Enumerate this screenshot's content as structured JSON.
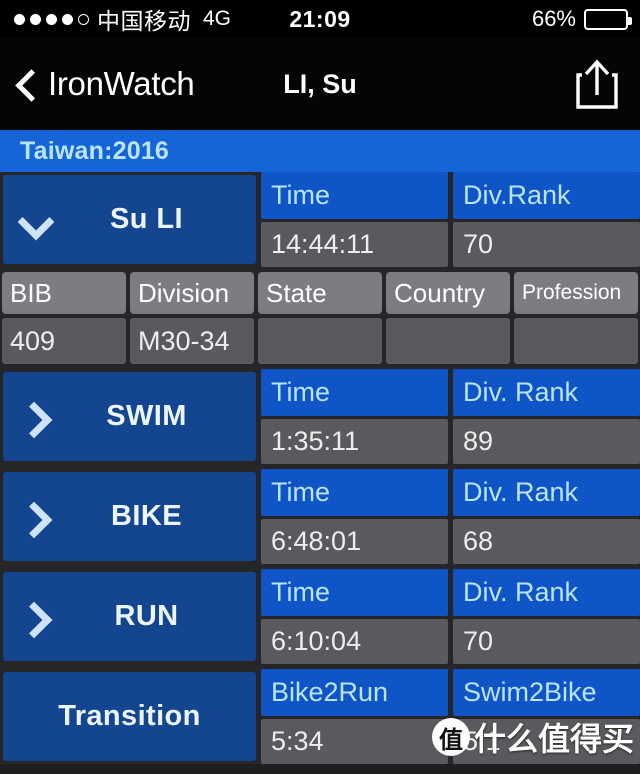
{
  "status_bar": {
    "signal_dots_total": 5,
    "signal_dots_filled": 4,
    "carrier": "中国移动",
    "network": "4G",
    "time": "21:09",
    "battery_percent": "66%",
    "battery_level": 66
  },
  "nav_bar": {
    "back_label": "IronWatch",
    "back_icon": "chevron-left-icon",
    "title": "LI, Su",
    "share_icon": "share-icon"
  },
  "race_header": {
    "label": "Taiwan:2016"
  },
  "athlete": {
    "name": "Su LI",
    "expand_icon": "chevron-down-icon",
    "stats": [
      {
        "head": "Time",
        "value": "14:44:11"
      },
      {
        "head": "Div.Rank",
        "value": "70"
      }
    ],
    "details": {
      "headers": [
        "BIB",
        "Division",
        "State",
        "Country",
        "Profession"
      ],
      "values": [
        "409",
        "M30-34",
        "",
        "",
        ""
      ]
    }
  },
  "segments": [
    {
      "name": "SWIM",
      "expand_icon": "chevron-right-icon",
      "stats": [
        {
          "head": "Time",
          "value": "1:35:11"
        },
        {
          "head": "Div. Rank",
          "value": "89"
        }
      ]
    },
    {
      "name": "BIKE",
      "expand_icon": "chevron-right-icon",
      "stats": [
        {
          "head": "Time",
          "value": "6:48:01"
        },
        {
          "head": "Div. Rank",
          "value": "68"
        }
      ]
    },
    {
      "name": "RUN",
      "expand_icon": "chevron-right-icon",
      "stats": [
        {
          "head": "Time",
          "value": "6:10:04"
        },
        {
          "head": "Div. Rank",
          "value": "70"
        }
      ]
    }
  ],
  "transition": {
    "name": "Transition",
    "stats": [
      {
        "head": "Bike2Run",
        "value": "5:34"
      },
      {
        "head": "Swim2Bike",
        "value": "5:1"
      }
    ]
  },
  "watermark": {
    "logo": "值",
    "text": "什么值得买"
  },
  "colors": {
    "accent_blue": "#1055c8",
    "panel_blue": "#14468f",
    "value_gray": "#5a5a5e",
    "header_gray": "#7c7c82",
    "page_bg": "#262628",
    "label_cyan": "#b9e4f2"
  }
}
